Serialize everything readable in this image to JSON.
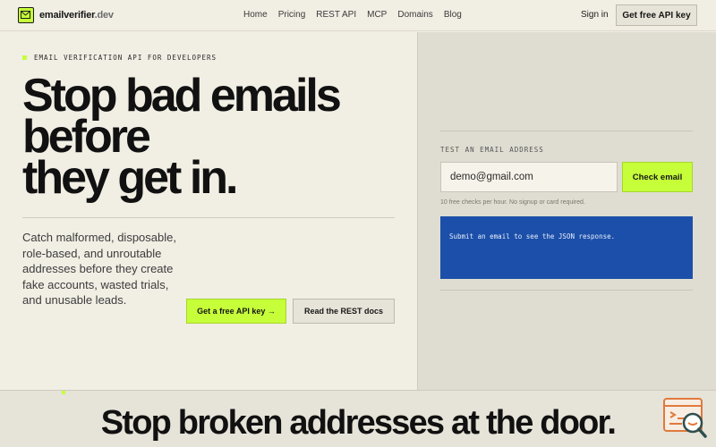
{
  "brand": {
    "name": "emailverifier",
    "tld": ".dev"
  },
  "nav": {
    "links": [
      "Home",
      "Pricing",
      "REST API",
      "MCP",
      "Domains",
      "Blog"
    ],
    "signin": "Sign in",
    "cta": "Get free API key"
  },
  "hero": {
    "eyebrow": "EMAIL VERIFICATION API FOR DEVELOPERS",
    "headline": [
      "Stop bad emails",
      "before",
      "they get in."
    ],
    "subcopy": "Catch malformed, disposable, role-based, and unroutable addresses before they create fake accounts, wasted trials, and unusable leads.",
    "cta_primary": "Get a free API key →",
    "cta_secondary": "Read the REST docs"
  },
  "tester": {
    "label": "TEST AN EMAIL ADDRESS",
    "input_value": "demo@gmail.com",
    "button": "Check email",
    "hint": "10 free checks per hour. No signup or card required.",
    "response": "Submit an email to see the JSON response."
  },
  "bottom": {
    "headline": "Stop broken addresses at the door."
  },
  "colors": {
    "accent": "#c6ff3a",
    "response_bg": "#1b4fa9",
    "page_bg": "#f1eee4",
    "panel_bg": "#dfddd2"
  },
  "icons": {
    "brand": "envelope-icon",
    "widget": "search-code-icon"
  }
}
